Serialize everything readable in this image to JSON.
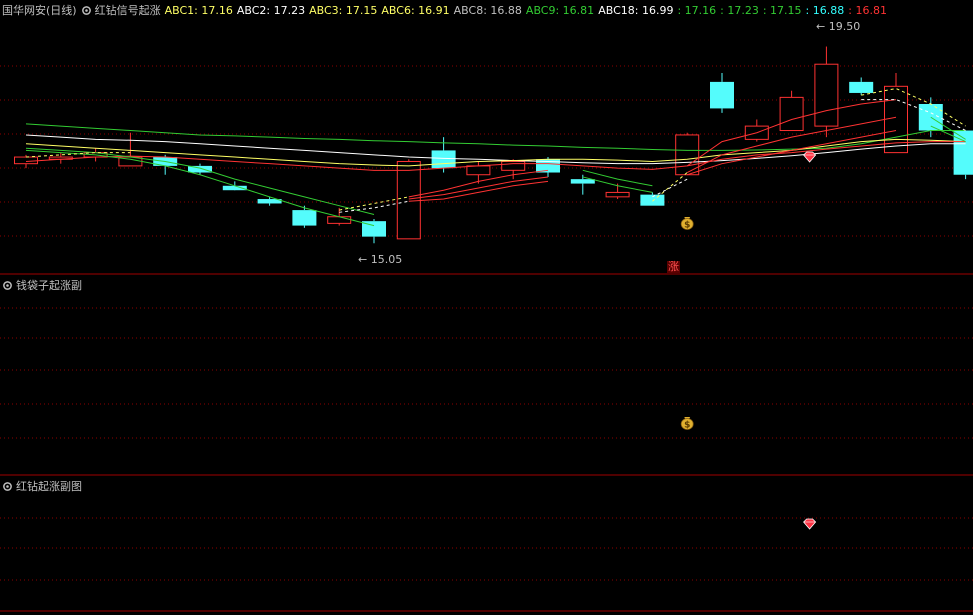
{
  "header": {
    "stock_name": "国华网安",
    "period": "(日线)",
    "indicator_name": "红钻信号起涨",
    "legend": [
      {
        "label": "ABC1: 17.16",
        "color": "#ffff66"
      },
      {
        "label": "ABC2: 17.23",
        "color": "#ffffff"
      },
      {
        "label": "ABC3: 17.15",
        "color": "#ffff66"
      },
      {
        "label": "ABC6: 16.91",
        "color": "#ffff66"
      },
      {
        "label": "ABC8: 16.88",
        "color": "#c0c0c0"
      },
      {
        "label": "ABC9: 16.81",
        "color": "#33cc33"
      },
      {
        "label": "ABC18: 16.99",
        "color": "#ffffff"
      },
      {
        "label": ": 17.16",
        "color": "#33cc33"
      },
      {
        "label": ": 17.23",
        "color": "#33cc33"
      },
      {
        "label": ": 17.15",
        "color": "#33cc33"
      },
      {
        "label": ": 16.88",
        "color": "#33ffff"
      },
      {
        "label": ": 16.81",
        "color": "#ff3333"
      }
    ]
  },
  "sub_panel_1": {
    "title": "钱袋子起涨副"
  },
  "sub_panel_2": {
    "title": "红钻起涨副图"
  },
  "annotations": {
    "high_label": "19.50",
    "low_label": "15.05",
    "rise_marker": "涨"
  },
  "colors": {
    "up": "#ff3232",
    "down": "#54fcfc",
    "grid": "#8b0000",
    "border": "#a00000"
  },
  "chart_data": {
    "type": "candlestick",
    "ylim": [
      14.4,
      20.1
    ],
    "candles": [
      {
        "o": 16.85,
        "h": 17.05,
        "l": 16.75,
        "c": 17.0
      },
      {
        "o": 16.95,
        "h": 17.1,
        "l": 16.85,
        "c": 17.0
      },
      {
        "o": 17.0,
        "h": 17.2,
        "l": 16.9,
        "c": 17.1
      },
      {
        "o": 16.8,
        "h": 17.55,
        "l": 16.8,
        "c": 17.0
      },
      {
        "o": 17.0,
        "h": 17.05,
        "l": 16.6,
        "c": 16.8
      },
      {
        "o": 16.8,
        "h": 16.85,
        "l": 16.6,
        "c": 16.65
      },
      {
        "o": 16.35,
        "h": 16.45,
        "l": 16.3,
        "c": 16.25
      },
      {
        "o": 16.05,
        "h": 16.1,
        "l": 15.9,
        "c": 15.95
      },
      {
        "o": 15.8,
        "h": 15.9,
        "l": 15.4,
        "c": 15.45
      },
      {
        "o": 15.5,
        "h": 15.85,
        "l": 15.45,
        "c": 15.65
      },
      {
        "o": 15.55,
        "h": 15.6,
        "l": 15.05,
        "c": 15.2
      },
      {
        "o": 15.15,
        "h": 16.95,
        "l": 15.15,
        "c": 16.9
      },
      {
        "o": 17.15,
        "h": 17.45,
        "l": 16.65,
        "c": 16.75
      },
      {
        "o": 16.6,
        "h": 16.9,
        "l": 16.4,
        "c": 16.8
      },
      {
        "o": 16.7,
        "h": 16.95,
        "l": 16.5,
        "c": 16.9
      },
      {
        "o": 16.95,
        "h": 17.0,
        "l": 16.55,
        "c": 16.65
      },
      {
        "o": 16.5,
        "h": 16.6,
        "l": 16.15,
        "c": 16.4
      },
      {
        "o": 16.1,
        "h": 16.4,
        "l": 16.05,
        "c": 16.2
      },
      {
        "o": 16.15,
        "h": 16.2,
        "l": 15.9,
        "c": 15.9
      },
      {
        "o": 16.6,
        "h": 17.55,
        "l": 16.6,
        "c": 17.5
      },
      {
        "o": 18.7,
        "h": 18.9,
        "l": 18.0,
        "c": 18.1
      },
      {
        "o": 17.4,
        "h": 17.85,
        "l": 17.35,
        "c": 17.7
      },
      {
        "o": 17.6,
        "h": 18.5,
        "l": 17.6,
        "c": 18.35
      },
      {
        "o": 17.7,
        "h": 19.5,
        "l": 17.45,
        "c": 19.1
      },
      {
        "o": 18.7,
        "h": 18.8,
        "l": 18.4,
        "c": 18.45
      },
      {
        "o": 17.1,
        "h": 18.9,
        "l": 17.1,
        "c": 18.6
      },
      {
        "o": 18.2,
        "h": 18.35,
        "l": 17.45,
        "c": 17.6
      },
      {
        "o": 17.6,
        "h": 17.6,
        "l": 16.5,
        "c": 16.6
      }
    ],
    "series": [
      {
        "color": "#33cc33",
        "values": [
          17.75,
          17.7,
          17.65,
          17.6,
          17.55,
          17.5,
          17.48,
          17.45,
          17.42,
          17.4,
          17.37,
          17.35,
          17.32,
          17.3,
          17.27,
          17.25,
          17.22,
          17.2,
          17.17,
          17.15,
          17.15,
          17.16,
          17.18,
          17.2,
          17.3,
          17.45,
          17.6,
          17.6
        ]
      },
      {
        "color": "#ffffff",
        "values": [
          17.5,
          17.45,
          17.4,
          17.38,
          17.35,
          17.3,
          17.25,
          17.2,
          17.15,
          17.1,
          17.05,
          17.0,
          16.97,
          16.95,
          16.92,
          16.9,
          16.87,
          16.85,
          16.85,
          16.88,
          16.92,
          16.97,
          17.03,
          17.1,
          17.18,
          17.25,
          17.3,
          17.3
        ]
      },
      {
        "color": "#ffff66",
        "values": [
          17.3,
          17.25,
          17.2,
          17.15,
          17.1,
          17.05,
          17.0,
          16.95,
          16.9,
          16.85,
          16.82,
          16.8,
          16.85,
          16.9,
          16.92,
          16.95,
          16.95,
          16.93,
          16.9,
          16.95,
          17.05,
          17.1,
          17.15,
          17.25,
          17.35,
          17.4,
          17.38,
          17.35
        ]
      },
      {
        "color": "#ff3333",
        "values": [
          16.9,
          16.95,
          17.0,
          17.02,
          17.0,
          16.95,
          16.9,
          16.85,
          16.8,
          16.75,
          16.7,
          16.7,
          16.75,
          16.8,
          16.85,
          16.85,
          16.8,
          16.75,
          16.72,
          16.8,
          16.95,
          17.05,
          17.1,
          17.18,
          17.25,
          17.32,
          17.35,
          17.35
        ]
      },
      {
        "color": "#33cc33",
        "values": [
          17.2,
          17.15,
          17.1,
          17.0,
          16.9,
          16.75,
          16.5,
          16.3,
          16.1,
          15.9,
          15.7,
          null,
          null,
          null,
          null,
          null,
          16.7,
          16.5,
          16.35,
          null,
          null,
          null,
          null,
          null,
          null,
          null,
          17.7,
          17.35
        ]
      },
      {
        "color": "#33cc33",
        "values": [
          17.15,
          17.1,
          17.05,
          16.95,
          16.8,
          16.6,
          16.35,
          16.1,
          15.85,
          15.65,
          15.45,
          null,
          null,
          null,
          null,
          null,
          16.55,
          16.35,
          16.2,
          null,
          null,
          null,
          null,
          null,
          null,
          null,
          17.9,
          17.4
        ]
      },
      {
        "color": "#ff3333",
        "values": [
          null,
          null,
          null,
          null,
          null,
          null,
          null,
          null,
          null,
          null,
          null,
          16.1,
          16.25,
          16.45,
          16.6,
          16.7,
          null,
          null,
          null,
          16.8,
          17.35,
          17.55,
          17.85,
          18.05,
          18.2,
          18.3,
          null,
          null
        ]
      },
      {
        "color": "#ff3333",
        "values": [
          null,
          null,
          null,
          null,
          null,
          null,
          null,
          null,
          null,
          null,
          null,
          16.05,
          16.15,
          16.3,
          16.45,
          16.55,
          null,
          null,
          null,
          16.65,
          17.05,
          17.25,
          17.45,
          17.6,
          17.75,
          17.9,
          null,
          null
        ]
      },
      {
        "color": "#ff3333",
        "values": [
          null,
          null,
          null,
          null,
          null,
          null,
          null,
          null,
          null,
          null,
          null,
          16.0,
          16.05,
          16.2,
          16.35,
          16.45,
          null,
          null,
          null,
          16.6,
          16.85,
          17.0,
          17.15,
          17.3,
          17.45,
          17.6,
          null,
          null
        ]
      }
    ],
    "dashed": [
      {
        "color": "#ffff66",
        "values": [
          17.0,
          17.05,
          17.1,
          17.1,
          null,
          null,
          null,
          null,
          null,
          15.8,
          15.95,
          16.1,
          null,
          null,
          null,
          null,
          null,
          null,
          16.0,
          16.65,
          null,
          null,
          null,
          null,
          18.4,
          18.55,
          18.2,
          17.7
        ]
      },
      {
        "color": "#ffffff",
        "values": [
          null,
          null,
          null,
          null,
          null,
          null,
          null,
          null,
          null,
          15.75,
          15.85,
          16.0,
          null,
          null,
          null,
          null,
          null,
          null,
          16.1,
          16.5,
          null,
          null,
          null,
          null,
          18.3,
          18.3,
          18.0,
          17.6
        ]
      }
    ],
    "markers": {
      "money_bag_index": 19,
      "diamond_index": 22,
      "rise_index": 19
    }
  }
}
